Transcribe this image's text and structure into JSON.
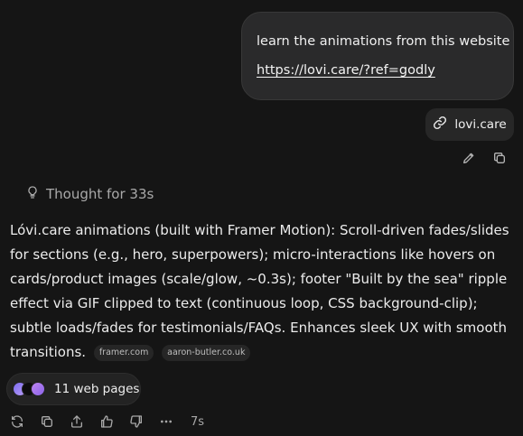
{
  "user_message": {
    "text": "learn the animations from this website",
    "link": "https://lovi.care/?ref=godly"
  },
  "source_chip": {
    "label": "lovi.care",
    "icon": "link-icon"
  },
  "message_actions": [
    "edit-icon",
    "copy-icon"
  ],
  "thought": {
    "label": "Thought for 33s",
    "icon": "lightbulb-icon"
  },
  "answer": {
    "text": "Lóvi.care animations (built with Framer Motion): Scroll-driven fades/slides for sections (e.g., hero, superpowers); micro-interactions like hovers on cards/product images (scale/glow, ~0.3s); footer \"Built by the sea\" ripple effect via GIF clipped to text (continuous loop, CSS background-clip); subtle loads/fades for testimonials/FAQs. Enhances sleek UX with smooth transitions.",
    "citations": [
      "framer.com",
      "aaron-butler.co.uk"
    ]
  },
  "web_pages": {
    "label": "11 web pages"
  },
  "bottom_actions": {
    "icons": [
      "regenerate-icon",
      "copy-icon",
      "share-icon",
      "thumbs-up-icon",
      "thumbs-down-icon",
      "more-icon"
    ],
    "elapsed": "7s"
  },
  "colors": {
    "background": "#151515",
    "bubble": "#2a2a2b",
    "muted": "#a9a9a9"
  }
}
